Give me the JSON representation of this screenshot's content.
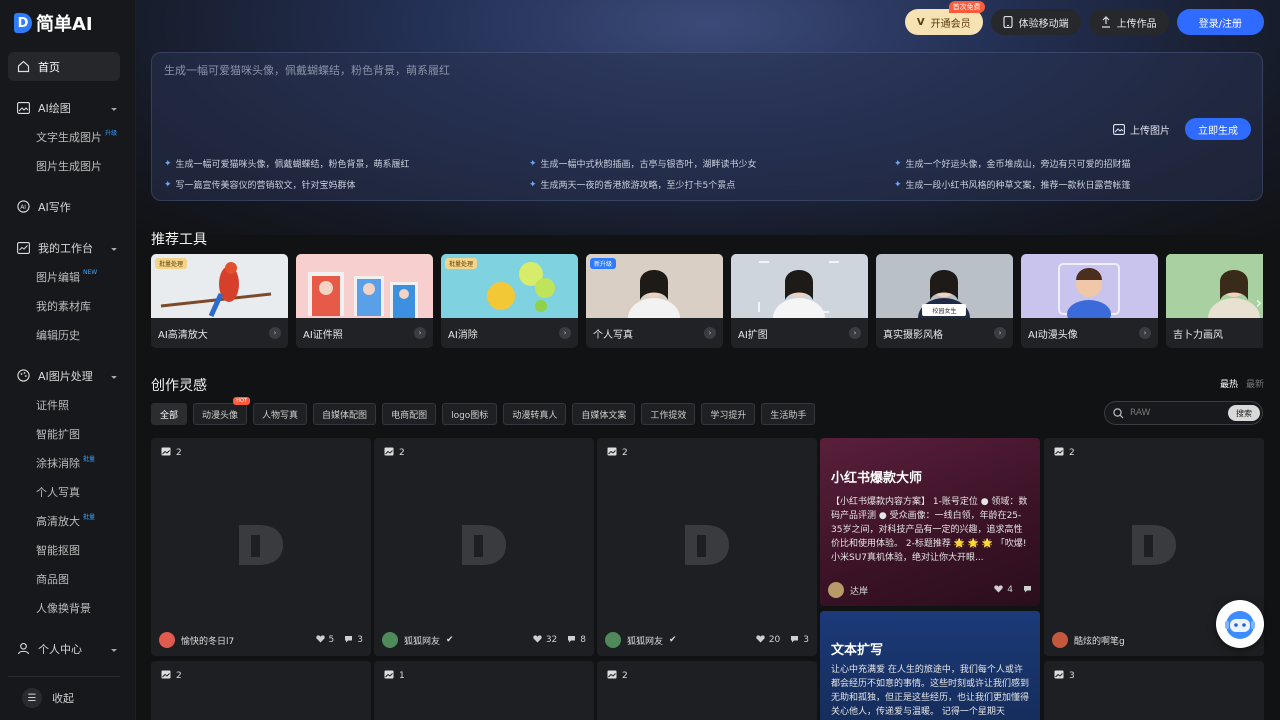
{
  "brand": {
    "name": "简单AI",
    "mark": "D"
  },
  "sidebar": {
    "items": [
      {
        "label": "首页",
        "icon": "home-icon",
        "type": "top",
        "active": true
      },
      {
        "label": "AI绘图",
        "icon": "image-icon",
        "type": "top",
        "expandable": true
      },
      {
        "label": "文字生成图片",
        "tag": "升级",
        "type": "sub"
      },
      {
        "label": "图片生成图片",
        "type": "sub"
      },
      {
        "label": "AI写作",
        "icon": "ai-write-icon",
        "type": "top"
      },
      {
        "label": "我的工作台",
        "icon": "chart-icon",
        "type": "top",
        "expandable": true
      },
      {
        "label": "图片编辑",
        "tag": "NEW",
        "type": "sub"
      },
      {
        "label": "我的素材库",
        "type": "sub"
      },
      {
        "label": "编辑历史",
        "type": "sub"
      },
      {
        "label": "AI图片处理",
        "icon": "palette-icon",
        "type": "top",
        "expandable": true
      },
      {
        "label": "证件照",
        "type": "sub"
      },
      {
        "label": "智能扩图",
        "type": "sub"
      },
      {
        "label": "涂抹消除",
        "tag": "批量",
        "type": "sub"
      },
      {
        "label": "个人写真",
        "type": "sub"
      },
      {
        "label": "高清放大",
        "tag": "批量",
        "type": "sub"
      },
      {
        "label": "智能抠图",
        "type": "sub"
      },
      {
        "label": "商品图",
        "type": "sub"
      },
      {
        "label": "人像换背景",
        "type": "sub"
      },
      {
        "label": "个人中心",
        "icon": "user-icon",
        "type": "top",
        "expandable": true
      }
    ],
    "collapse_label": "收起"
  },
  "topbar": {
    "vip_label": "开通会员",
    "vip_badge": "首次免费",
    "mobile_label": "体验移动端",
    "upload_label": "上传作品",
    "login_label": "登录/注册"
  },
  "prompt": {
    "placeholder": "生成一幅可爱猫咪头像，佩戴蝴蝶结，粉色背景，萌系履红",
    "upload_label": "上传图片",
    "generate_label": "立即生成",
    "suggestions": [
      "生成一幅可爱猫咪头像，佩戴蝴蝶结，粉色背景，萌系履红",
      "生成一幅中式秋韵插画，古亭与银杏叶，湖畔读书少女",
      "生成一个好运头像，金币堆成山，旁边有只可爱的招财猫",
      "写一篇宣传美容仪的营销软文，针对宝妈群体",
      "生成两天一夜的香港旅游攻略，至少打卡5个景点",
      "生成一段小红书风格的种草文案，推荐一款秋日露营帐篷"
    ]
  },
  "tools": {
    "title": "推荐工具",
    "items": [
      {
        "label": "AI高清放大",
        "tag": "批量处理",
        "tag_style": "gold",
        "bg": "#e9ecef"
      },
      {
        "label": "AI证件照",
        "tag": "",
        "tag_style": "",
        "bg": "#f7cfcf"
      },
      {
        "label": "AI消除",
        "tag": "批量处理",
        "tag_style": "gold",
        "bg": "#7fd3e0"
      },
      {
        "label": "个人写真",
        "tag": "新升级",
        "tag_style": "blue",
        "bg": "#d8ccc0"
      },
      {
        "label": "AI扩图",
        "tag": "",
        "tag_style": "",
        "bg": "#cfd5dc"
      },
      {
        "label": "真实摄影风格",
        "tag": "",
        "tag_style": "",
        "bg": "#b9c0c8",
        "sign": "校园女生"
      },
      {
        "label": "AI动漫头像",
        "tag": "",
        "tag_style": "",
        "bg": "#c9c4ee"
      },
      {
        "label": "吉卜力画风",
        "tag": "",
        "tag_style": "",
        "bg": "#9fc59a"
      }
    ]
  },
  "inspiration": {
    "title": "创作灵感",
    "sort_hot": "最热",
    "sort_new": "最新",
    "filters": [
      "全部",
      "动漫头像",
      "人物写真",
      "自媒体配图",
      "电商配图",
      "logo图标",
      "动漫转真人",
      "自媒体文案",
      "工作提效",
      "学习提升",
      "生活助手"
    ],
    "hot_badge": "HOT",
    "search_placeholder": "RAW",
    "search_button": "搜索",
    "cards": [
      {
        "count": "2",
        "user": "愉快的冬日l7",
        "likes": "5",
        "comments": "3",
        "avatar_color": "#e05a4e"
      },
      {
        "count": "2",
        "user": "狐狐网友",
        "likes": "32",
        "comments": "8",
        "avatar_color": "#4f8a5b"
      },
      {
        "count": "2",
        "user": "狐狐网友",
        "likes": "20",
        "comments": "3",
        "avatar_color": "#4f8a5b"
      },
      {
        "count": "2",
        "user": "酷炫的啊笔g",
        "likes": "",
        "comments": "",
        "avatar_color": "#c4583d"
      }
    ],
    "row2_counts": [
      "2",
      "1",
      "2",
      "3"
    ],
    "text_cards": [
      {
        "title": "小红书爆款大师",
        "body": "【小红书爆款内容方案】 1-账号定位 ● 领域：数码产品评测 ● 受众画像：一线白领，年龄在25-35岁之间，对科技产品有一定的兴趣，追求高性价比和使用体验。 2-标题推荐 🌟 🌟 🌟 「吹爆! 小米SU7真机体验，绝对让你大开眼...",
        "user": "达岸",
        "likes": "4"
      },
      {
        "title": "文本扩写",
        "body": "让心中充满爱 在人生的旅途中，我们每个人或许都会经历不如意的事情。这些时刻或许让我们感到无助和孤独，但正是这些经历，也让我们更加懂得关心他人，传递爱与温暖。 记得一个星期天"
      }
    ]
  }
}
